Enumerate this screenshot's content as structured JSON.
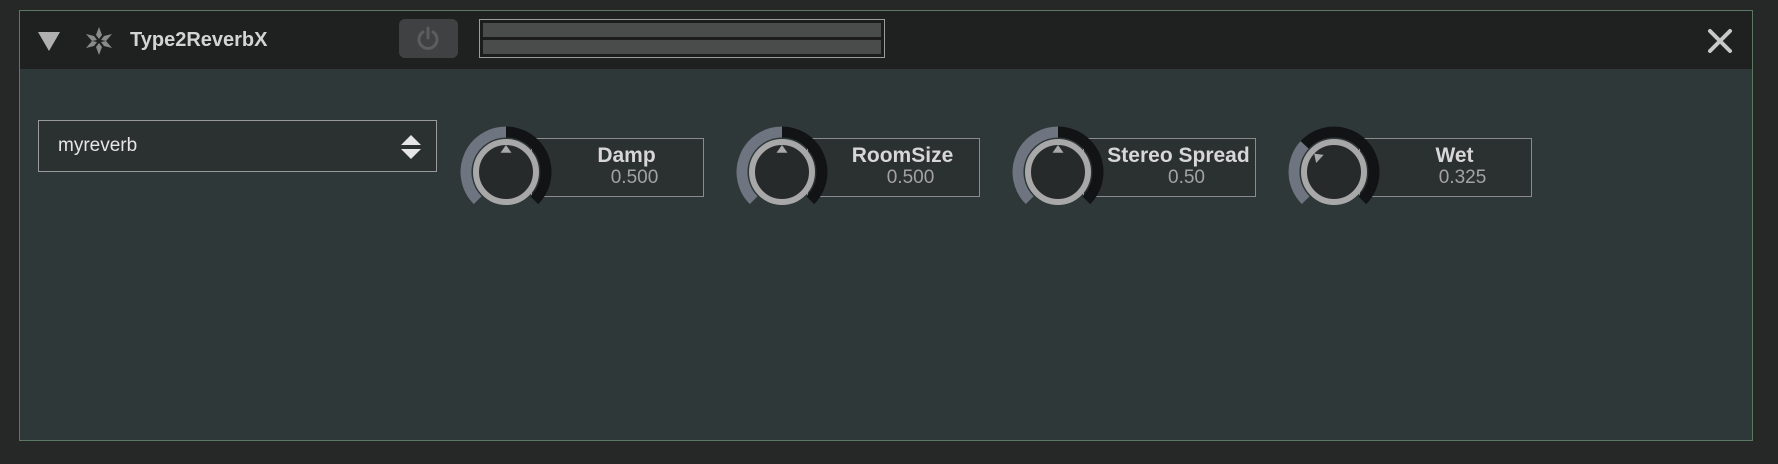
{
  "module": {
    "title": "Type2ReverbX",
    "icons": {
      "collapse": "triangle-down-icon",
      "module": "flake-icon",
      "power": "power-icon",
      "close": "close-icon"
    }
  },
  "preset": {
    "value": "myreverb"
  },
  "params": [
    {
      "label": "Damp",
      "value": "0.500",
      "level": 0.5
    },
    {
      "label": "RoomSize",
      "value": "0.500",
      "level": 0.5
    },
    {
      "label": "Stereo Spread",
      "value": "0.50",
      "level": 0.5
    },
    {
      "label": "Wet",
      "value": "0.325",
      "level": 0.325
    }
  ],
  "colors": {
    "background": "#262828",
    "panel": "#2f3839",
    "border": "#5c7863",
    "knob_arc_fill": "#6e7480",
    "knob_arc_track": "#121314"
  }
}
